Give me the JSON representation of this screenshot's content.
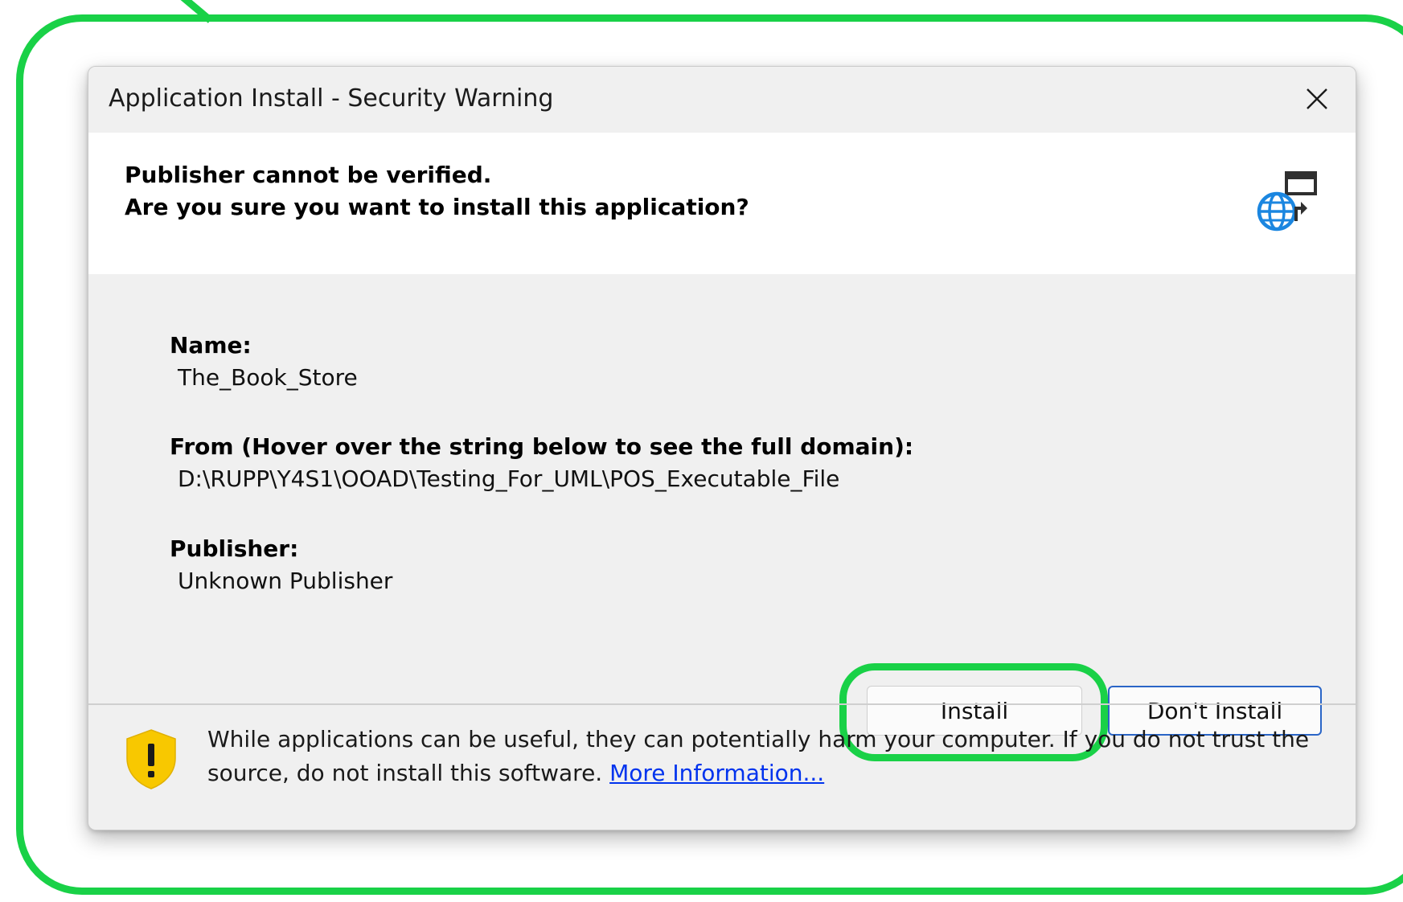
{
  "dialog": {
    "title": "Application Install - Security Warning",
    "close_icon": "close-icon"
  },
  "header": {
    "line1": "Publisher cannot be verified.",
    "line2": "Are you sure you want to install this application?",
    "icon": "globe-install-icon"
  },
  "details": {
    "name_label": "Name:",
    "name_value": "The_Book_Store",
    "from_label": "From (Hover over the string below to see the full domain):",
    "from_value": "D:\\RUPP\\Y4S1\\OOAD\\Testing_For_UML\\POS_Executable_File",
    "publisher_label": "Publisher:",
    "publisher_value": "Unknown Publisher"
  },
  "buttons": {
    "install": "Install",
    "dont_install": "Don't Install"
  },
  "footer": {
    "warning_text": "While applications can be useful, they can potentially harm your computer. If you do not trust the source, do not install this software.",
    "link_text": "More Information...",
    "icon": "shield-warning-icon"
  },
  "colors": {
    "annotation": "#19d147",
    "dialog_bg": "#f0f0f0",
    "focus_border": "#2a65c7",
    "link": "#0033ee",
    "shield": "#f8c800"
  }
}
